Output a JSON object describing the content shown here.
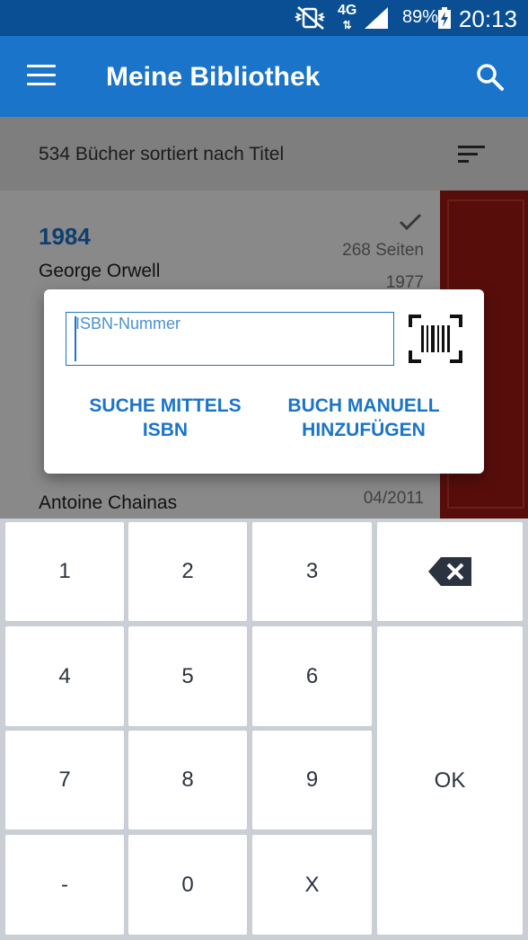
{
  "status_bar": {
    "network": "4G",
    "battery_percent": "89%",
    "time": "20:13"
  },
  "app_bar": {
    "title": "Meine Bibliothek"
  },
  "sort_bar": {
    "summary": "534 Bücher sortiert nach Titel"
  },
  "list": {
    "items": [
      {
        "title": "1984",
        "author": "George Orwell",
        "pages": "268 Seiten",
        "year": "1977"
      },
      {
        "author": "Antoine Chainas",
        "date": "04/2011"
      }
    ]
  },
  "dialog": {
    "isbn_placeholder": "ISBN-Nummer",
    "search_button": "SUCHE MITTELS ISBN",
    "manual_button": "BUCH MANUELL HINZUFÜGEN"
  },
  "keyboard": {
    "keys": [
      "1",
      "2",
      "3",
      "4",
      "5",
      "6",
      "7",
      "8",
      "9",
      "-",
      "0",
      "X"
    ],
    "ok_label": "OK"
  },
  "colors": {
    "status_bar": "#0a4f94",
    "app_bar": "#1a74c9",
    "accent": "#1a74c9",
    "cover": "#9e1a14",
    "keyboard_bg": "#c9cfd4"
  }
}
